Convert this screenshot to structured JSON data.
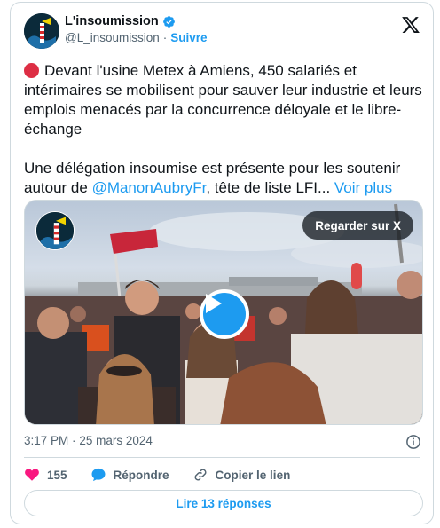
{
  "author": {
    "display_name": "L'insoumission",
    "handle": "@L_insoumission",
    "separator": "·",
    "follow_label": "Suivre"
  },
  "tweet": {
    "paragraph1": "Devant l'usine Metex à Amiens, 450 salariés et intérimaires se mobilisent pour sauver leur industrie et leurs emplois menacés par la concurrence déloyale et le libre-échange",
    "paragraph2_prefix": "Une délégation insoumise est présente pour les soutenir autour de ",
    "mention": "@ManonAubryFr",
    "paragraph2_suffix": ", tête de liste LFI... ",
    "see_more": "Voir plus"
  },
  "media": {
    "watch_label": "Regarder sur X"
  },
  "meta": {
    "time": "3:17 PM",
    "separator": "·",
    "date": "25 mars 2024"
  },
  "actions": {
    "likes": "155",
    "reply_label": "Répondre",
    "copy_label": "Copier le lien"
  },
  "read_replies": "Lire 13 réponses",
  "colors": {
    "accent": "#1d9bf0",
    "like": "#f91880",
    "text": "#0f1419",
    "muted": "#536471",
    "border": "#cfd9de"
  }
}
